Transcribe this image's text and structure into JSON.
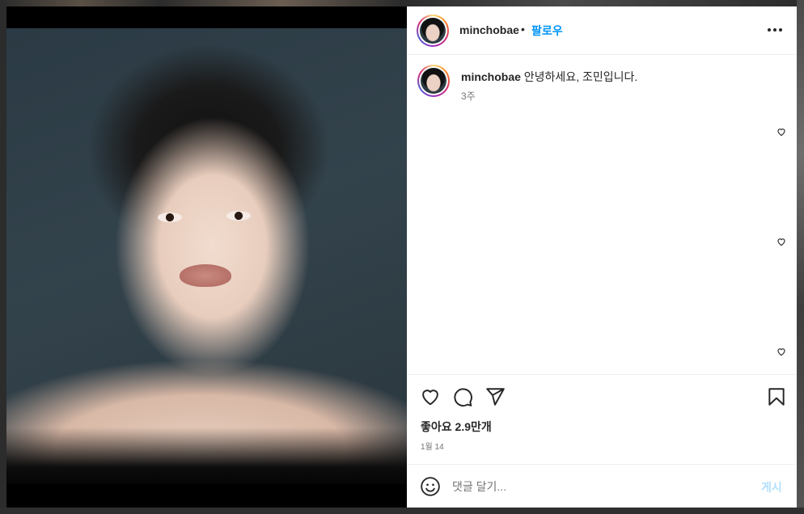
{
  "post": {
    "username": "minchobae",
    "separator": "•",
    "follow_label": "팔로우",
    "caption": "안녕하세요, 조민입니다.",
    "caption_time": "3주",
    "likes_label": "좋아요 2.9만개",
    "date_label": "1월 14",
    "comment_placeholder": "댓글 달기...",
    "post_label": "게시"
  },
  "icons": {
    "more": "more-options-icon",
    "like": "heart-icon",
    "comment": "comment-icon",
    "share": "send-icon",
    "save": "bookmark-icon",
    "emoji": "emoji-icon"
  },
  "colors": {
    "accent": "#0095f6",
    "post_disabled": "#b2dffc",
    "text": "#262626",
    "secondary": "#737373"
  }
}
